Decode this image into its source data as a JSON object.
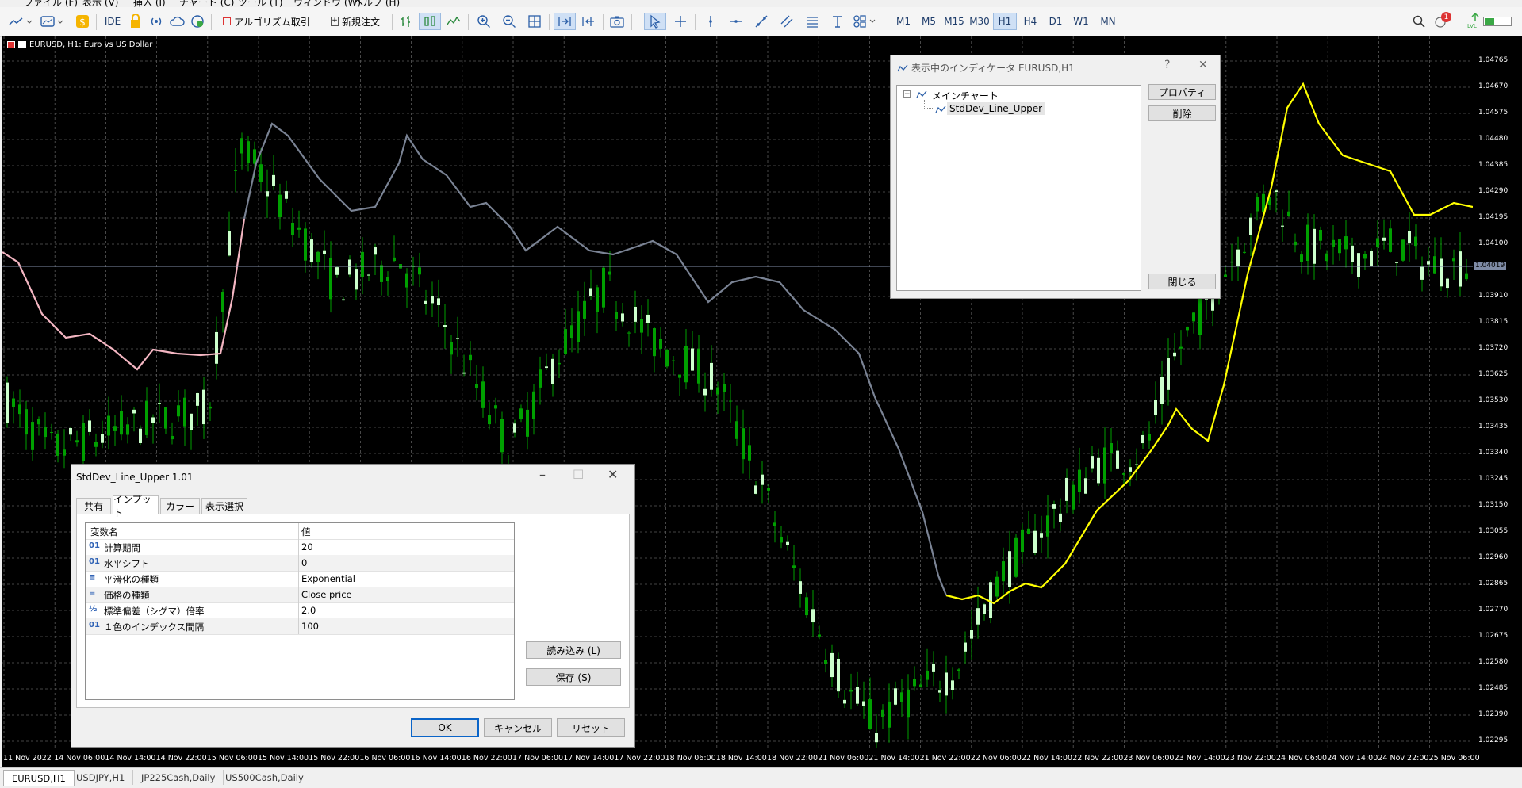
{
  "menu": [
    "ファイル (F)",
    "表示 (V)",
    "挿入 (I)",
    "チャート (C)",
    "ツール (T)",
    "ウィンドウ (W)",
    "ヘルプ (H)"
  ],
  "toolbar": {
    "ide_label": "IDE",
    "algo_label": "アルゴリズム取引",
    "new_order_label": "新規注文",
    "timeframes": [
      "M1",
      "M5",
      "M15",
      "M30",
      "H1",
      "H4",
      "D1",
      "W1",
      "MN"
    ],
    "active_timeframe": "H1",
    "notification_count": "1",
    "signal_label": "LVL"
  },
  "chart": {
    "title": "EURUSD, H1:  Euro vs US Dollar",
    "price_labels": [
      "1.04765",
      "1.04670",
      "1.04575",
      "1.04480",
      "1.04385",
      "1.04290",
      "1.04195",
      "1.04100",
      "1.03910",
      "1.03815",
      "1.03720",
      "1.03625",
      "1.03530",
      "1.03435",
      "1.03340",
      "1.03245",
      "1.03150",
      "1.03055",
      "1.02960",
      "1.02865",
      "1.02770",
      "1.02675",
      "1.02580",
      "1.02485",
      "1.02390",
      "1.02295"
    ],
    "current_price": "1.04019",
    "time_labels": [
      "11 Nov 2022",
      "14 Nov 06:00",
      "14 Nov 14:00",
      "14 Nov 22:00",
      "15 Nov 06:00",
      "15 Nov 14:00",
      "15 Nov 22:00",
      "16 Nov 06:00",
      "16 Nov 14:00",
      "16 Nov 22:00",
      "17 Nov 06:00",
      "17 Nov 14:00",
      "17 Nov 22:00",
      "18 Nov 06:00",
      "18 Nov 14:00",
      "18 Nov 22:00",
      "21 Nov 06:00",
      "21 Nov 14:00",
      "21 Nov 22:00",
      "22 Nov 06:00",
      "22 Nov 14:00",
      "22 Nov 22:00",
      "23 Nov 06:00",
      "23 Nov 14:00",
      "23 Nov 22:00",
      "24 Nov 06:00",
      "24 Nov 14:00",
      "24 Nov 22:00",
      "25 Nov 06:00"
    ],
    "colors": {
      "bull": "#ccffcc",
      "bear": "#00a000",
      "line_pink": "#f4b6c2",
      "line_gray": "#7a8394",
      "line_yellow": "#ffff00",
      "grid": "#5a5a5a"
    }
  },
  "indicator_dialog": {
    "title": "表示中のインディケータ EURUSD,H1",
    "help": "?",
    "tree_root": "メインチャート",
    "tree_child": "StdDev_Line_Upper",
    "properties_button": "プロパティ",
    "delete_button": "削除",
    "close_button": "閉じる"
  },
  "properties_dialog": {
    "title": "StdDev_Line_Upper 1.01",
    "tabs": [
      "共有",
      "インプット",
      "カラー",
      "表示選択"
    ],
    "active_tab": "インプット",
    "header_name": "変数名",
    "header_value": "値",
    "params": [
      {
        "icon": "01",
        "name": "計算期間",
        "value": "20"
      },
      {
        "icon": "01",
        "name": "水平シフト",
        "value": "0"
      },
      {
        "icon": "≡",
        "name": "平滑化の種類",
        "value": "Exponential"
      },
      {
        "icon": "≡",
        "name": "価格の種類",
        "value": "Close price"
      },
      {
        "icon": "½",
        "name": "標準偏差（シグマ）倍率",
        "value": "2.0"
      },
      {
        "icon": "01",
        "name": "１色のインデックス間隔",
        "value": "100"
      }
    ],
    "load_button": "読み込み (L)",
    "save_button": "保存 (S)",
    "ok_button": "OK",
    "cancel_button": "キャンセル",
    "reset_button": "リセット"
  },
  "tabs": [
    "EURUSD,H1",
    "USDJPY,H1",
    "JP225Cash,Daily",
    "US500Cash,Daily"
  ],
  "active_tab": "EURUSD,H1"
}
